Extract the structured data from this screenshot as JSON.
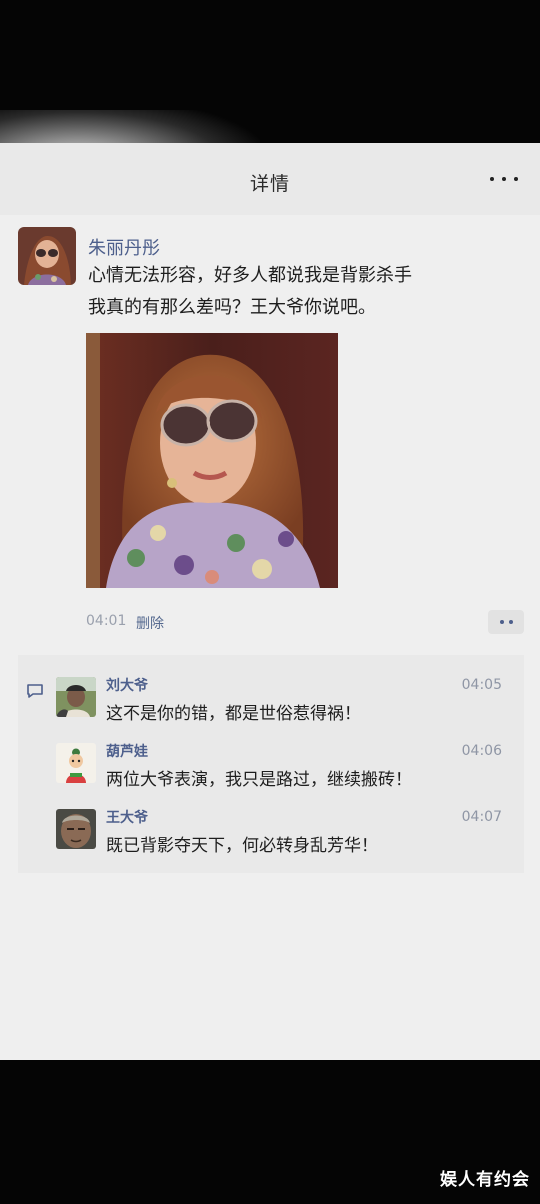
{
  "header": {
    "title": "详情"
  },
  "post": {
    "author": "朱丽丹彤",
    "text_lines": [
      "心情无法形容，好多人都说我是背影杀手",
      "我真的有那么差吗？王大爷你说吧。"
    ],
    "time": "04:01",
    "delete_label": "删除"
  },
  "comments": [
    {
      "name": "刘大爷",
      "time": "04:05",
      "text": "这不是你的错，都是世俗惹得祸！"
    },
    {
      "name": "葫芦娃",
      "time": "04:06",
      "text": "两位大爷表演，我只是路过，继续搬砖！"
    },
    {
      "name": "王大爷",
      "time": "04:07",
      "text": "既已背影夺天下，何必转身乱芳华！"
    }
  ],
  "watermark": "娱人有约会",
  "colors": {
    "name_blue": "#4d5f8c",
    "screen_bg": "#efefef",
    "comment_bg": "#e9e9e9"
  }
}
